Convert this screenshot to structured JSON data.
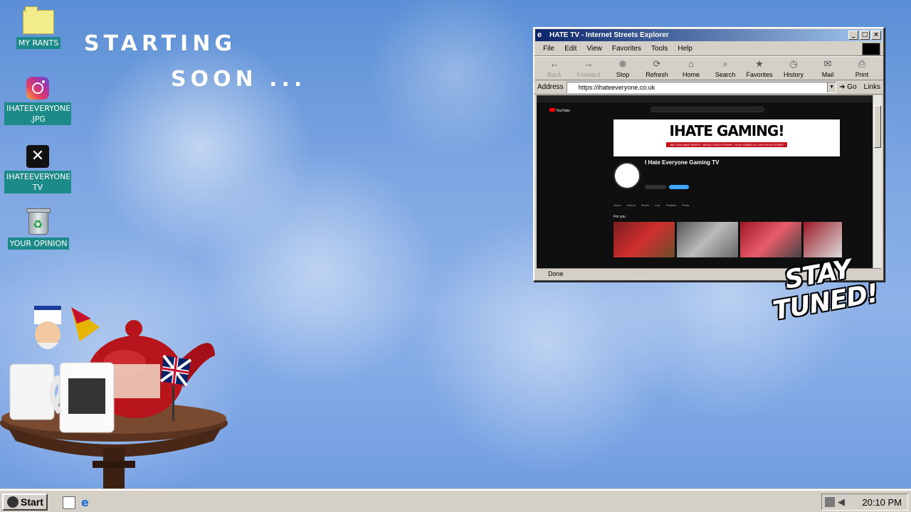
{
  "desktop": {
    "icons": [
      {
        "label": "MY RANTS",
        "icon": "folder-icon"
      },
      {
        "label": "IHATEEVERYONE .JPG",
        "icon": "instagram-icon"
      },
      {
        "label": "IHATEEVERYONE TV",
        "icon": "x-logo-icon"
      },
      {
        "label": "YOUR OPINION",
        "icon": "recycle-bin-icon"
      }
    ],
    "overlay_text": {
      "line1": "STARTING",
      "line2": "SOON ..."
    },
    "stay_tuned": {
      "line1": "STAY",
      "line2": "TUNED!"
    }
  },
  "browser": {
    "title": "HATE TV - Internet Streets Explorer",
    "menu": [
      "File",
      "Edit",
      "View",
      "Favorites",
      "Tools",
      "Help"
    ],
    "toolbar": [
      {
        "label": "Back",
        "icon": "back-arrow-icon",
        "enabled": false
      },
      {
        "label": "Forward",
        "icon": "forward-arrow-icon",
        "enabled": false
      },
      {
        "label": "Stop",
        "icon": "stop-icon",
        "enabled": true
      },
      {
        "label": "Refresh",
        "icon": "refresh-icon",
        "enabled": true
      },
      {
        "label": "Home",
        "icon": "home-icon",
        "enabled": true
      },
      {
        "label": "Search",
        "icon": "search-icon",
        "enabled": true
      },
      {
        "label": "Favorites",
        "icon": "favorites-icon",
        "enabled": true
      },
      {
        "label": "History",
        "icon": "history-icon",
        "enabled": true
      },
      {
        "label": "Mail",
        "icon": "mail-icon",
        "enabled": true
      },
      {
        "label": "Print",
        "icon": "print-icon",
        "enabled": true
      }
    ],
    "address_label": "Address",
    "address_value": "https://ihateeveryone.co.uk",
    "go_label": "Go",
    "links_label": "Links",
    "status": "Done",
    "page": {
      "site": "YouTube",
      "banner_title": "IHATE GAMING!",
      "banner_tagline": "WE CAN HAVE RANTS - INSULT EACH OTHER - PLAY GAMES & LOVE EACH OTHER",
      "channel_name": "I Hate Everyone Gaming TV",
      "section": "For you",
      "tabs": [
        "Home",
        "Videos",
        "Shorts",
        "Live",
        "Playlists",
        "Posts"
      ]
    }
  },
  "taskbar": {
    "start_label": "Start",
    "clock": "20:10 PM"
  },
  "colors": {
    "icon_label_bg": "#1d8a8a",
    "titlebar": "#0a246a",
    "banner_red": "#c4121c"
  }
}
